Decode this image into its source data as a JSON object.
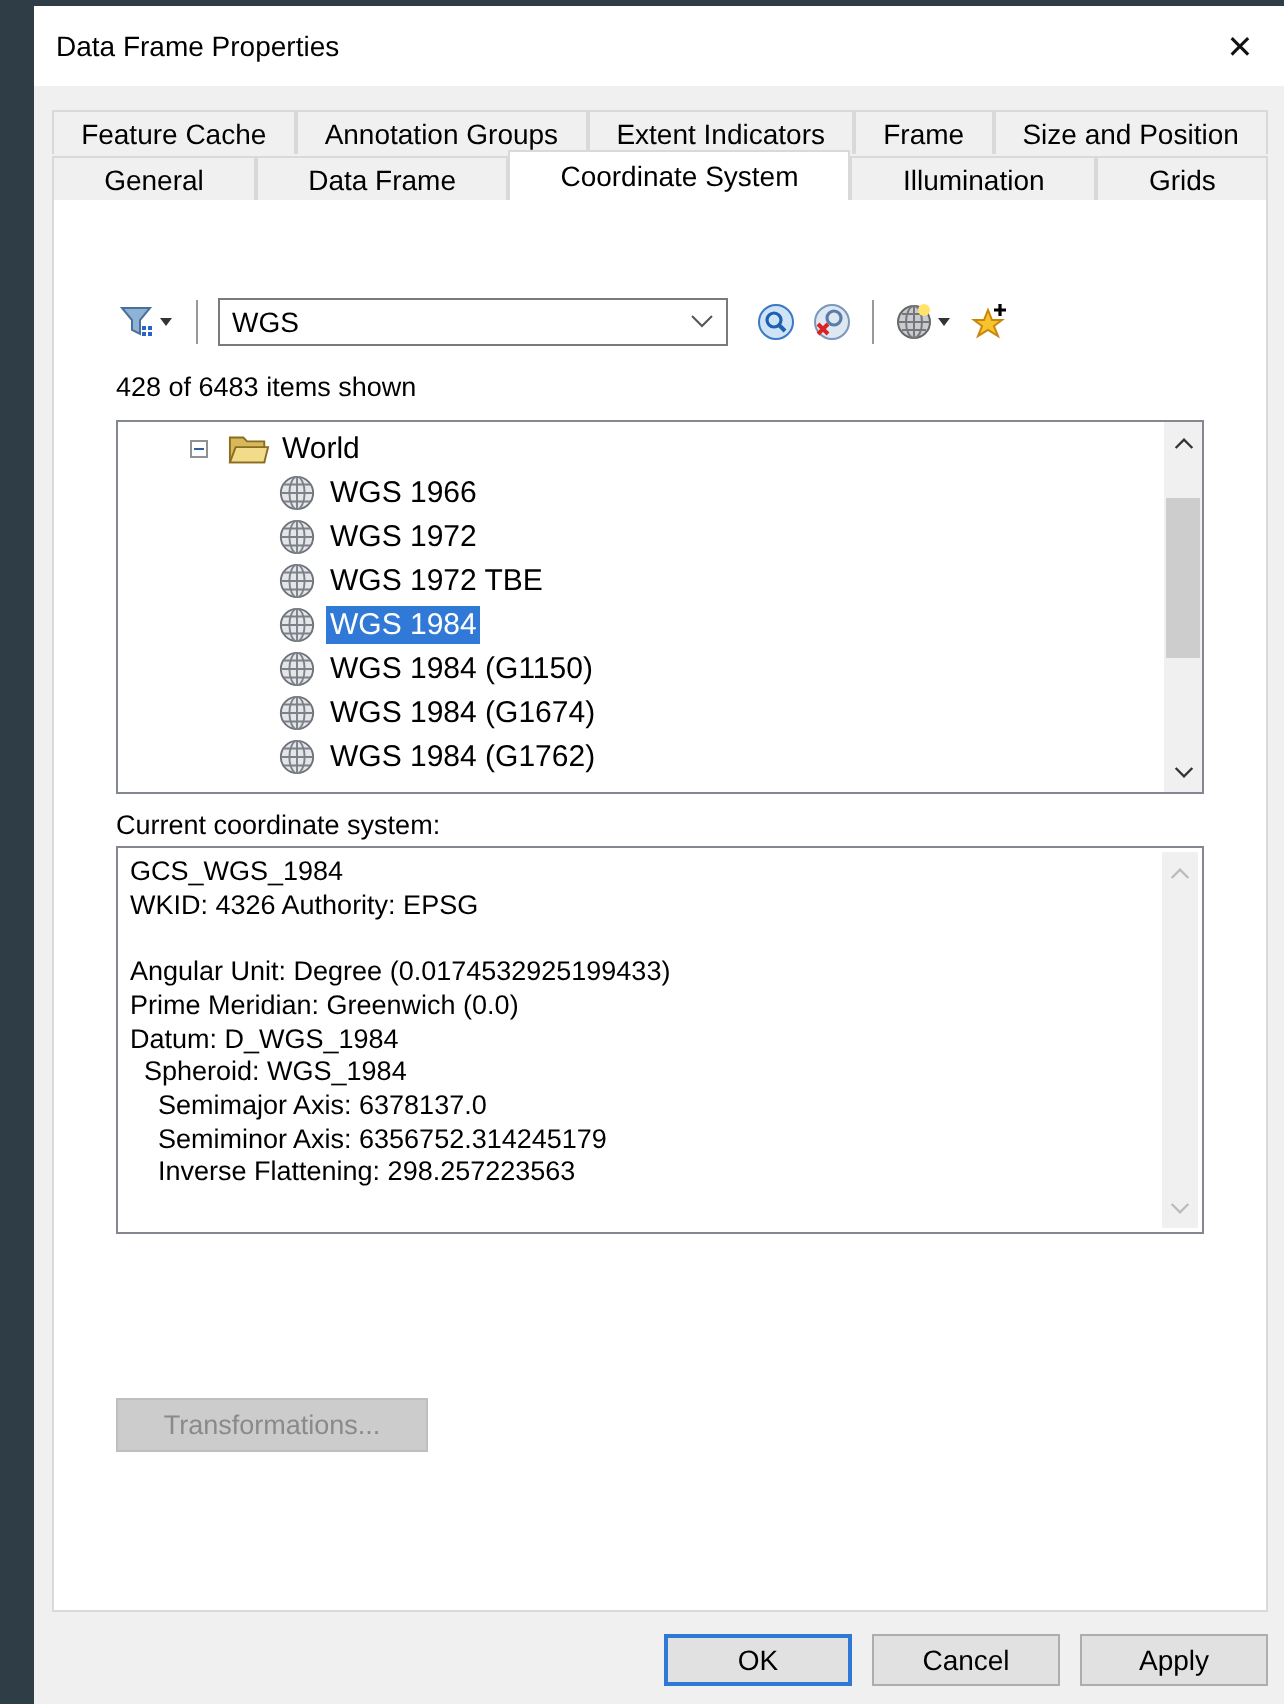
{
  "window": {
    "title": "Data Frame Properties",
    "close": "✕"
  },
  "tab_rows": [
    [
      {
        "label": "Feature Cache",
        "selected": false
      },
      {
        "label": "Annotation Groups",
        "selected": false
      },
      {
        "label": "Extent Indicators",
        "selected": false
      },
      {
        "label": "Frame",
        "selected": false
      },
      {
        "label": "Size and Position",
        "selected": false
      }
    ],
    [
      {
        "label": "General",
        "selected": false
      },
      {
        "label": "Data Frame",
        "selected": false
      },
      {
        "label": "Coordinate System",
        "selected": true
      },
      {
        "label": "Illumination",
        "selected": false
      },
      {
        "label": "Grids",
        "selected": false
      }
    ]
  ],
  "search": {
    "value": "WGS"
  },
  "count": "428 of 6483 items shown",
  "tree": [
    {
      "label": "World",
      "kind": "folder",
      "expanded": true,
      "selected": false,
      "children": [
        {
          "label": "WGS 1966",
          "kind": "system",
          "selected": false
        },
        {
          "label": "WGS 1972",
          "kind": "system",
          "selected": false
        },
        {
          "label": "WGS 1972 TBE",
          "kind": "system",
          "selected": false
        },
        {
          "label": "WGS 1984",
          "kind": "system",
          "selected": true
        },
        {
          "label": "WGS 1984 (G1150)",
          "kind": "system",
          "selected": false
        },
        {
          "label": "WGS 1984 (G1674)",
          "kind": "system",
          "selected": false
        },
        {
          "label": "WGS 1984 (G1762)",
          "kind": "system",
          "selected": false
        }
      ]
    }
  ],
  "current_label": "Current coordinate system:",
  "details": [
    {
      "text": "GCS_WGS_1984"
    },
    {
      "text": "WKID: 4326 Authority: EPSG"
    },
    {
      "text": "Angular Unit: Degree (0.0174532925199433)",
      "gap_before": true
    },
    {
      "text": "Prime Meridian: Greenwich (0.0)"
    },
    {
      "text": "Datum: D_WGS_1984",
      "children": [
        {
          "text": "Spheroid: WGS_1984",
          "children": [
            {
              "text": "Semimajor Axis: 6378137.0"
            },
            {
              "text": "Semiminor Axis: 6356752.314245179"
            },
            {
              "text": "Inverse Flattening: 298.257223563"
            }
          ]
        }
      ]
    }
  ],
  "transformations": {
    "label": "Transformations...",
    "disabled": true
  },
  "buttons": [
    {
      "label": "OK",
      "default": true
    },
    {
      "label": "Cancel",
      "default": false
    },
    {
      "label": "Apply",
      "default": false
    }
  ]
}
